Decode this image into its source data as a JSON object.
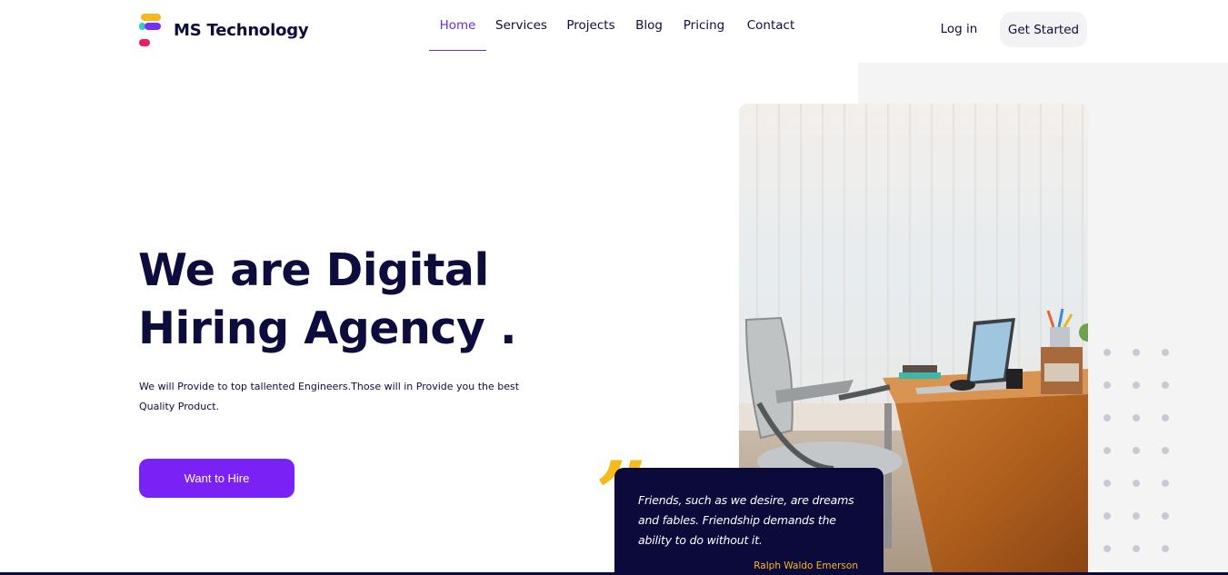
{
  "brand": {
    "name": "MS Technology",
    "colors": {
      "primary": "#7a22f5",
      "dark": "#0e0b3d",
      "accent": "#f8b91d"
    }
  },
  "nav": {
    "items": [
      {
        "label": "Home",
        "active": true
      },
      {
        "label": "Services"
      },
      {
        "label": "Projects"
      },
      {
        "label": "Blog"
      },
      {
        "label": "Pricing"
      },
      {
        "label": "Contact"
      }
    ],
    "login": "Log in",
    "cta": "Get Started"
  },
  "hero": {
    "title_line1": "We are Digital",
    "title_line2": "Hiring Agency .",
    "description": "We will Provide to top tallented Engineers.Those will in Provide you the best Quality Product.",
    "button": "Want to Hire"
  },
  "quote": {
    "mark": "”",
    "text": "Friends, such as we desire, are dreams and fables. Friendship demands the ability to do without it.",
    "author": "Ralph Waldo Emerson"
  }
}
